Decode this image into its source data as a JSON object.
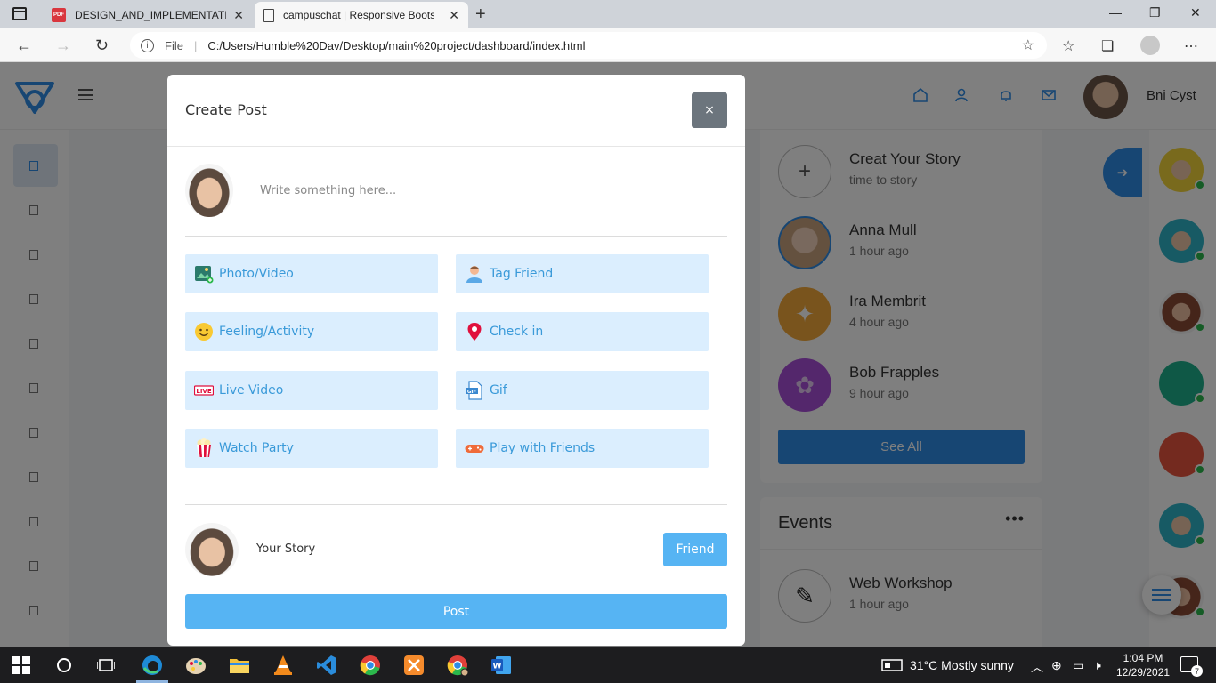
{
  "browser": {
    "tabs": [
      {
        "title": "DESIGN_AND_IMPLEMENTATION",
        "icon": "pdf-icon",
        "active": false
      },
      {
        "title": "campuschat | Responsive Bootstr",
        "icon": "page-icon",
        "active": true
      }
    ],
    "address": {
      "scheme_label": "File",
      "url": "C:/Users/Humble%20Dav/Desktop/main%20project/dashboard/index.html"
    }
  },
  "app": {
    "header": {
      "username": "Bni Cyst"
    },
    "stories": [
      {
        "name": "Creat Your Story",
        "time": "time to story"
      },
      {
        "name": "Anna Mull",
        "time": "1 hour ago"
      },
      {
        "name": "Ira Membrit",
        "time": "4 hour ago"
      },
      {
        "name": "Bob Frapples",
        "time": "9 hour ago"
      }
    ],
    "see_all_label": "See All",
    "events": {
      "title": "Events",
      "items": [
        {
          "name": "Web Workshop",
          "time": "1 hour ago"
        }
      ]
    }
  },
  "modal": {
    "title": "Create Post",
    "close_label": "×",
    "input_placeholder": "Write something here...",
    "options": [
      {
        "label": "Photo/Video",
        "icon": "photo-icon"
      },
      {
        "label": "Tag Friend",
        "icon": "tag-friend-icon"
      },
      {
        "label": "Feeling/Activity",
        "icon": "smiley-icon"
      },
      {
        "label": "Check in",
        "icon": "location-pin-icon"
      },
      {
        "label": "Live Video",
        "icon": "live-icon"
      },
      {
        "label": "Gif",
        "icon": "gif-icon"
      },
      {
        "label": "Watch Party",
        "icon": "popcorn-icon"
      },
      {
        "label": "Play with Friends",
        "icon": "gamepad-icon"
      }
    ],
    "story_label": "Your Story",
    "friend_label": "Friend",
    "post_label": "Post"
  },
  "taskbar": {
    "weather": "31°C  Mostly sunny",
    "time": "1:04 PM",
    "date": "12/29/2021",
    "notification_count": "7"
  },
  "colors": {
    "accent": "#2f8ce6",
    "modal_button": "#56b4f3",
    "option_bg": "#dbeefe",
    "option_text": "#3a9ad9",
    "online": "#2bb94c"
  }
}
